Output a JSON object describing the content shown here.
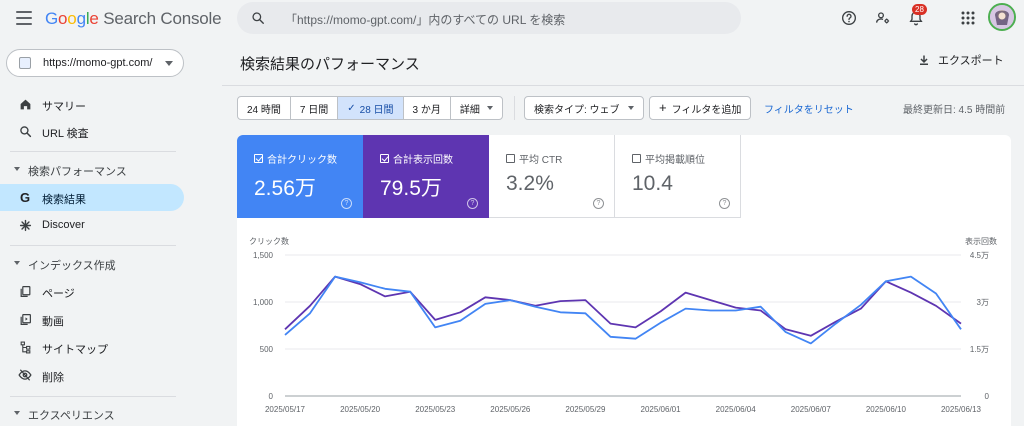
{
  "header": {
    "logo": {
      "g": "G",
      "o1": "o",
      "o2": "o",
      "g2": "g",
      "l": "l",
      "e": "e",
      "rest": " Search Console"
    },
    "search_placeholder": "「https://momo-gpt.com/」内のすべての URL を検索",
    "notification_count": "28",
    "icons": [
      "menu-icon",
      "search-icon",
      "help-icon",
      "manage-accounts-icon",
      "notifications-icon",
      "apps-icon"
    ]
  },
  "sidebar": {
    "property": "https://momo-gpt.com/",
    "items": [
      {
        "label": "サマリー",
        "icon": "home-icon"
      },
      {
        "label": "URL 検査",
        "icon": "search-icon"
      }
    ],
    "sections": [
      {
        "label": "検索パフォーマンス",
        "items": [
          {
            "label": "検索結果",
            "icon": "google-g-icon",
            "active": true
          },
          {
            "label": "Discover",
            "icon": "asterisk-icon"
          }
        ]
      },
      {
        "label": "インデックス作成",
        "items": [
          {
            "label": "ページ",
            "icon": "pages-icon"
          },
          {
            "label": "動画",
            "icon": "video-icon"
          },
          {
            "label": "サイトマップ",
            "icon": "sitemap-icon"
          },
          {
            "label": "削除",
            "icon": "visibility-off-icon"
          }
        ]
      },
      {
        "label": "エクスペリエンス",
        "items": []
      }
    ]
  },
  "main": {
    "title": "検索結果のパフォーマンス",
    "export_label": "エクスポート",
    "ranges": [
      "24 時間",
      "7 日間",
      "28 日間",
      "3 か月",
      "詳細"
    ],
    "active_range": "28 日間",
    "search_type": "検索タイプ: ウェブ",
    "add_filter": "フィルタを追加",
    "reset_filter": "フィルタをリセット",
    "last_updated": "最終更新日: 4.5 時間前",
    "metrics": [
      {
        "label": "合計クリック数",
        "value": "2.56万",
        "checked": true
      },
      {
        "label": "合計表示回数",
        "value": "79.5万",
        "checked": true
      },
      {
        "label": "平均 CTR",
        "value": "3.2%",
        "checked": false
      },
      {
        "label": "平均掲載順位",
        "value": "10.4",
        "checked": false
      }
    ],
    "colors": {
      "clicks": "#4285f4",
      "impressions": "#5e35b1",
      "active_nav": "#c2e7ff"
    }
  },
  "chart_data": {
    "type": "line",
    "ylabel": "クリック数",
    "y2label": "表示回数",
    "ylim": [
      0,
      1500
    ],
    "y2lim": [
      0,
      45000
    ],
    "yticks": [
      "1,500",
      "1,000",
      "500",
      "0"
    ],
    "y2ticks": [
      "4.5万",
      "3万",
      "1.5万",
      "0"
    ],
    "x_labels": [
      "2025/05/17",
      "2025/05/20",
      "2025/05/23",
      "2025/05/26",
      "2025/05/29",
      "2025/06/01",
      "2025/06/04",
      "2025/06/07",
      "2025/06/10",
      "2025/06/13"
    ],
    "x": [
      "2025/05/17",
      "2025/05/18",
      "2025/05/19",
      "2025/05/20",
      "2025/05/21",
      "2025/05/22",
      "2025/05/23",
      "2025/05/24",
      "2025/05/25",
      "2025/05/26",
      "2025/05/27",
      "2025/05/28",
      "2025/05/29",
      "2025/05/30",
      "2025/05/31",
      "2025/06/01",
      "2025/06/02",
      "2025/06/03",
      "2025/06/04",
      "2025/06/05",
      "2025/06/06",
      "2025/06/07",
      "2025/06/08",
      "2025/06/09",
      "2025/06/10",
      "2025/06/11",
      "2025/06/12",
      "2025/06/13"
    ],
    "series": [
      {
        "name": "クリック数",
        "axis": "left",
        "color": "#4285f4",
        "values": [
          650,
          880,
          1270,
          1210,
          1140,
          1110,
          730,
          800,
          980,
          1020,
          950,
          890,
          880,
          630,
          610,
          780,
          930,
          910,
          910,
          950,
          680,
          560,
          770,
          970,
          1220,
          1270,
          1090,
          710
        ]
      },
      {
        "name": "表示回数",
        "axis": "right",
        "color": "#5e35b1",
        "values": [
          21300,
          28800,
          38100,
          35700,
          31800,
          33300,
          24300,
          26700,
          31500,
          30600,
          28800,
          30300,
          30600,
          23100,
          21900,
          27000,
          33000,
          30600,
          28200,
          27300,
          21300,
          19200,
          23700,
          27900,
          36600,
          33000,
          28800,
          23100
        ]
      }
    ]
  }
}
